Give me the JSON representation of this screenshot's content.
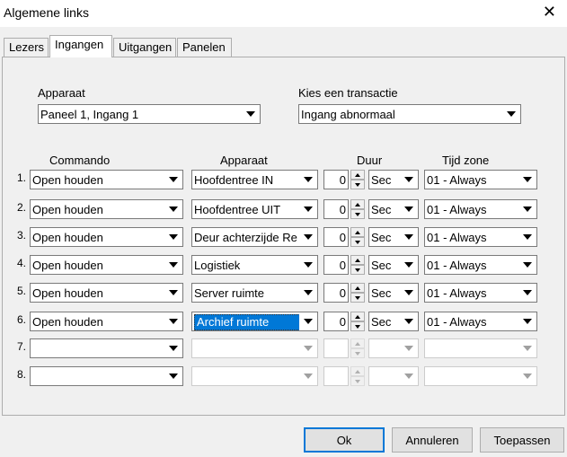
{
  "window": {
    "title": "Algemene links"
  },
  "tabs": [
    {
      "label": "Lezers",
      "active": false
    },
    {
      "label": "Ingangen",
      "active": true
    },
    {
      "label": "Uitgangen",
      "active": false
    },
    {
      "label": "Panelen",
      "active": false
    }
  ],
  "source": {
    "apparaat_label": "Apparaat",
    "apparaat_value": "Paneel 1, Ingang 1",
    "transaction_label": "Kies een transactie",
    "transaction_value": "Ingang abnormaal"
  },
  "columns": {
    "commando": "Commando",
    "apparaat": "Apparaat",
    "duur": "Duur",
    "tijdzone": "Tijd zone"
  },
  "rows": [
    {
      "num": "1.",
      "commando": "Open houden",
      "apparaat": "Hoofdentree IN",
      "duur": "0",
      "unit": "Sec",
      "tijdzone": "01 - Always"
    },
    {
      "num": "2.",
      "commando": "Open houden",
      "apparaat": "Hoofdentree UIT",
      "duur": "0",
      "unit": "Sec",
      "tijdzone": "01 - Always"
    },
    {
      "num": "3.",
      "commando": "Open houden",
      "apparaat": "Deur achterzijde Re",
      "duur": "0",
      "unit": "Sec",
      "tijdzone": "01 - Always"
    },
    {
      "num": "4.",
      "commando": "Open houden",
      "apparaat": "Logistiek",
      "duur": "0",
      "unit": "Sec",
      "tijdzone": "01 - Always"
    },
    {
      "num": "5.",
      "commando": "Open houden",
      "apparaat": "Server ruimte",
      "duur": "0",
      "unit": "Sec",
      "tijdzone": "01 - Always"
    },
    {
      "num": "6.",
      "commando": "Open houden",
      "apparaat": "Archief ruimte",
      "duur": "0",
      "unit": "Sec",
      "tijdzone": "01 - Always"
    },
    {
      "num": "7.",
      "commando": "",
      "apparaat": "",
      "duur": "",
      "unit": "",
      "tijdzone": ""
    },
    {
      "num": "8.",
      "commando": "",
      "apparaat": "",
      "duur": "",
      "unit": "",
      "tijdzone": ""
    }
  ],
  "buttons": {
    "ok": "Ok",
    "cancel": "Annuleren",
    "apply": "Toepassen"
  },
  "colors": {
    "selection": "#0078d7",
    "default_button_border": "#0078d7"
  }
}
